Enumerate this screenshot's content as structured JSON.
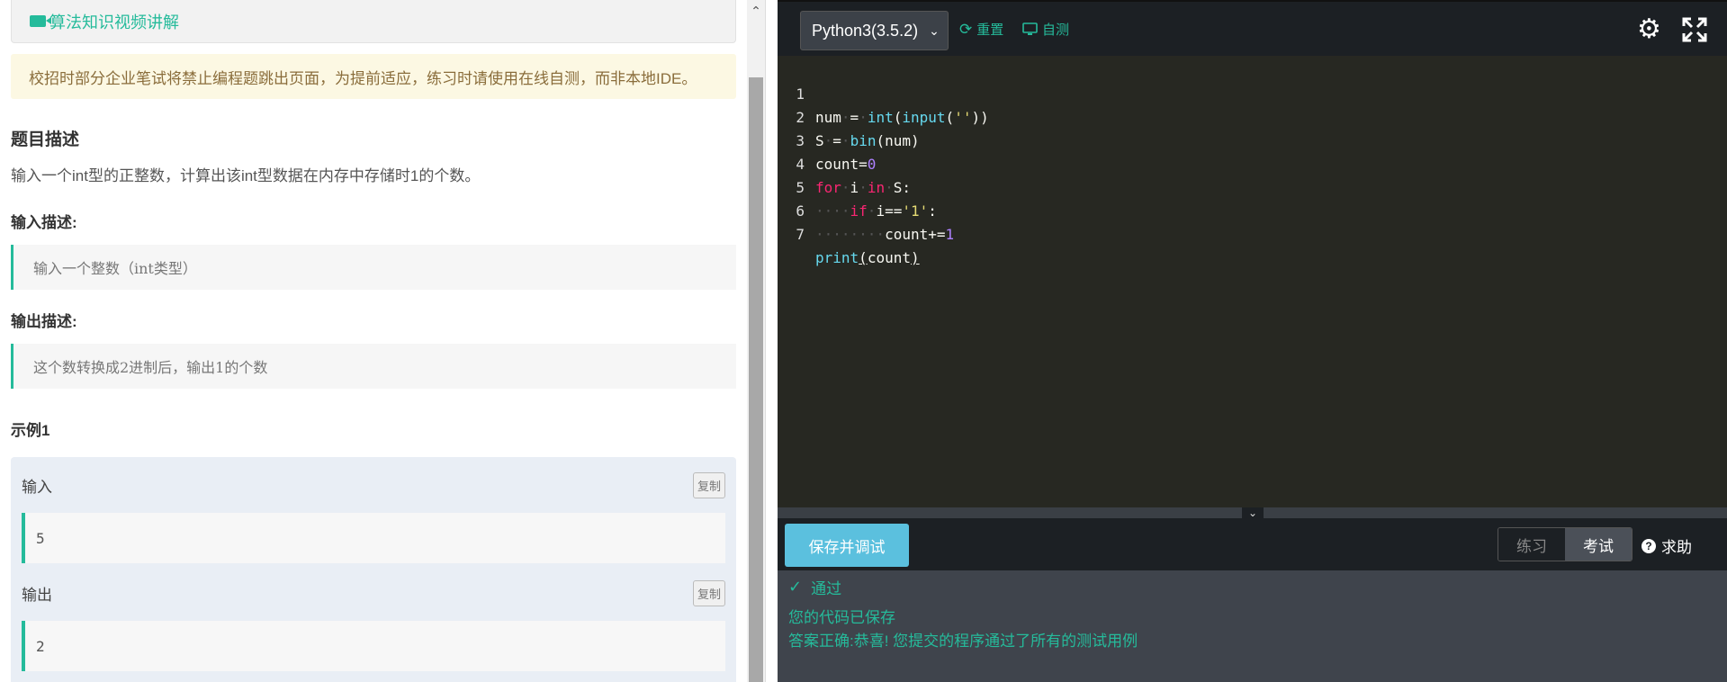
{
  "left": {
    "video_label": "算法知识视频讲解",
    "notice": "校招时部分企业笔试将禁止编程题跳出页面，为提前适应，练习时请使用在线自测，而非本地IDE。",
    "problem_title": "题目描述",
    "problem_desc": "输入一个int型的正整数，计算出该int型数据在内存中存储时1的个数。",
    "input_title": "输入描述:",
    "input_desc": "输入一个整数（int类型）",
    "output_title": "输出描述:",
    "output_desc": "这个数转换成2进制后，输出1的个数",
    "example_title": "示例1",
    "example": {
      "input_label": "输入",
      "input_value": "5",
      "output_label": "输出",
      "output_value": "2",
      "copy_label": "复制"
    }
  },
  "right": {
    "language": "Python3(3.5.2)",
    "reset_label": "重置",
    "selftest_label": "自测",
    "line_numbers": [
      "1",
      "2",
      "3",
      "4",
      "5",
      "6",
      "7"
    ],
    "save_label": "保存并调试",
    "modes": [
      "练习",
      "考试"
    ],
    "active_mode": "考试",
    "help_label": "求助",
    "result": {
      "status": "通过",
      "saved": "您的代码已保存",
      "answer": "答案正确:恭喜! 您提交的程序通过了所有的测试用例"
    },
    "accent_color": "#25bb9b"
  }
}
